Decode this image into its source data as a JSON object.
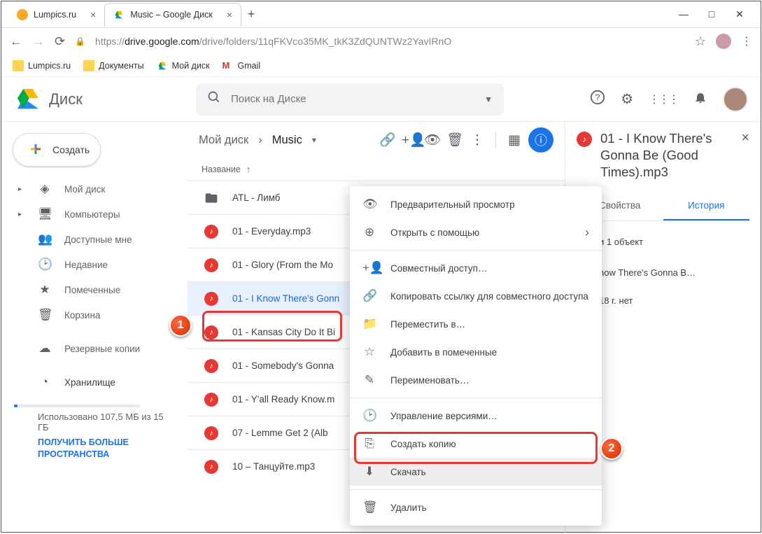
{
  "browser": {
    "tabs": [
      {
        "title": "Lumpics.ru",
        "active": false
      },
      {
        "title": "Music – Google Диск",
        "active": true
      }
    ],
    "url_prefix": "https://",
    "url_host": "drive.google.com",
    "url_path": "/drive/folders/11qFKVco35MK_tkK3ZdQUNTWz2YavIRnO",
    "bookmarks": [
      {
        "label": "Lumpics.ru"
      },
      {
        "label": "Документы"
      },
      {
        "label": "Мой диск"
      },
      {
        "label": "Gmail"
      }
    ]
  },
  "drive": {
    "logo_text": "Диск",
    "search_placeholder": "Поиск на Диске",
    "create_btn": "Создать"
  },
  "sidebar": {
    "items": [
      {
        "label": "Мой диск",
        "caret": true
      },
      {
        "label": "Компьютеры",
        "caret": true
      },
      {
        "label": "Доступные мне",
        "caret": false
      },
      {
        "label": "Недавние",
        "caret": false
      },
      {
        "label": "Помеченные",
        "caret": false
      },
      {
        "label": "Корзина",
        "caret": false
      }
    ],
    "backups": "Резервные копии",
    "storage": "Хранилище",
    "storage_used": "Использовано 107,5 МБ из 15 ГБ",
    "storage_link": "ПОЛУЧИТЬ БОЛЬШЕ ПРОСТРАНСТВА"
  },
  "breadcrumbs": {
    "root": "Мой диск",
    "current": "Music"
  },
  "column_header": "Название",
  "files": [
    {
      "name": "ATL - Лимб",
      "type": "folder"
    },
    {
      "name": "01 - Everyday.mp3",
      "type": "audio"
    },
    {
      "name": "01 - Glory (From the Mo",
      "type": "audio"
    },
    {
      "name": "01 - I Know There's Gonn",
      "type": "audio",
      "selected": true
    },
    {
      "name": "01 - Kansas City Do It Bi",
      "type": "audio"
    },
    {
      "name": "01 - Somebody's Gonna",
      "type": "audio"
    },
    {
      "name": "01 - Y'all Ready Know.m",
      "type": "audio"
    },
    {
      "name": "07 - Lemme Get 2 (Alb",
      "type": "audio"
    },
    {
      "name": "10 – Танцуйте.mp3",
      "type": "audio"
    }
  ],
  "context_menu": {
    "items": [
      {
        "label": "Предварительный просмотр",
        "icon": "eye"
      },
      {
        "label": "Открыть с помощью",
        "icon": "open",
        "submenu": true
      }
    ],
    "items2": [
      {
        "label": "Совместный доступ…",
        "icon": "share"
      },
      {
        "label": "Копировать ссылку для совместного доступа",
        "icon": "link"
      },
      {
        "label": "Переместить в…",
        "icon": "move"
      },
      {
        "label": "Добавить в помеченные",
        "icon": "star"
      },
      {
        "label": "Переименовать…",
        "icon": "rename"
      }
    ],
    "items3": [
      {
        "label": "Управление версиями…",
        "icon": "history"
      },
      {
        "label": "Создать копию",
        "icon": "copy"
      },
      {
        "label": "Скачать",
        "icon": "download",
        "highlight": true
      }
    ],
    "items4": [
      {
        "label": "Удалить",
        "icon": "trash"
      }
    ]
  },
  "details": {
    "title": "01 - I Know There's Gonna Be (Good Times).mp3",
    "tab_info": "Свойства",
    "tab_history": "История",
    "history_line1": "и 1 объект",
    "history_line2": "now There's Gonna B…",
    "history_line3": "18 г. нет"
  },
  "callouts": {
    "one": "1",
    "two": "2"
  }
}
